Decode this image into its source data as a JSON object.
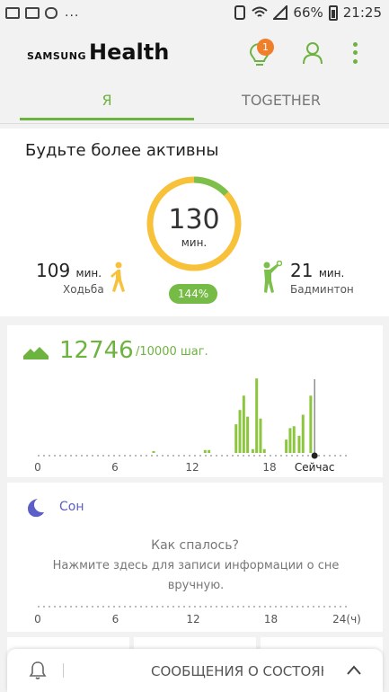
{
  "status_bar": {
    "battery": "66%",
    "time": "21:25"
  },
  "app": {
    "logo_samsung": "SAMSUNG",
    "logo_health": "Health",
    "notification_badge": "1"
  },
  "tabs": [
    {
      "label": "Я",
      "active": true
    },
    {
      "label": "TOGETHER",
      "active": false
    }
  ],
  "activity": {
    "title": "Будьте более активны",
    "total_minutes": "130",
    "minutes_unit": "мин.",
    "goal_percent_label": "144%",
    "ring_fraction": 0.13,
    "walking": {
      "value": "109",
      "unit": "мин.",
      "label": "Ходьба"
    },
    "badminton": {
      "value": "21",
      "unit": "мин.",
      "label": "Бадминтон"
    }
  },
  "steps": {
    "count": "12746",
    "goal_text": "/10000 шаг.",
    "x_ticks": [
      "0",
      "6",
      "12",
      "18"
    ],
    "now_label": "Сейчас",
    "now_hour": 21.5,
    "chart_data": {
      "type": "bar",
      "xlabel": "",
      "ylabel": "",
      "x_range": [
        0,
        24
      ],
      "x": [
        9,
        13,
        13.3,
        15.4,
        15.7,
        16,
        16.3,
        16.7,
        17,
        17.3,
        17.6,
        19.3,
        19.6,
        19.9,
        20.3,
        20.6,
        21.2
      ],
      "values": [
        2,
        3,
        3,
        30,
        45,
        60,
        38,
        4,
        78,
        36,
        4,
        14,
        26,
        28,
        18,
        40,
        60
      ]
    }
  },
  "sleep": {
    "title": "Сон",
    "question": "Как спалось?",
    "hint": "Нажмите здесь для записи информации о сне вручную.",
    "x_ticks": [
      "0",
      "6",
      "12",
      "18",
      "24(ч)"
    ]
  },
  "notification_bar": {
    "text": "СООБЩЕНИЯ О СОСТОЯНИИ"
  },
  "colors": {
    "accent_green": "#6db33f",
    "ring_yellow": "#f8c13a",
    "badge_orange": "#f07f2a",
    "sleep_purple": "#5b5fc7"
  }
}
